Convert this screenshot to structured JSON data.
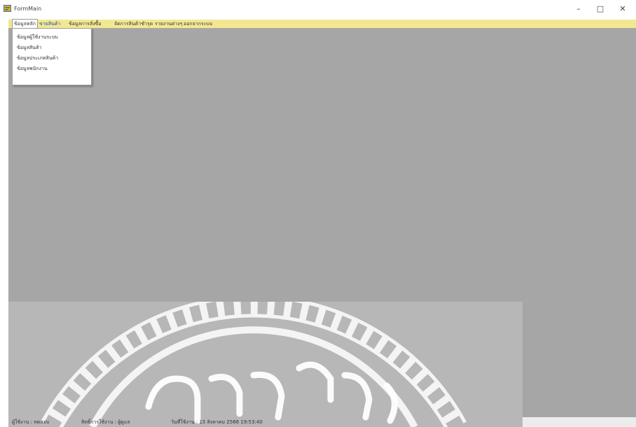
{
  "window": {
    "title": "FormMain",
    "minimize_glyph": "–",
    "maximize_glyph": "□",
    "close_glyph": "✕",
    "icon": "app-form-icon"
  },
  "menu": {
    "items": [
      {
        "label": "ข้อมูลหลัก",
        "state": "open"
      },
      {
        "label": "ขายสินค้า",
        "state": "highlighted"
      },
      {
        "label": "ข้อมูลการสั่งซื้อ",
        "state": "normal"
      },
      {
        "label": "จัดการสินค้าชำรุด",
        "state": "normal"
      },
      {
        "label": "รายงานต่างๆ",
        "state": "normal"
      },
      {
        "label": "ออกจากระบบ",
        "state": "normal"
      }
    ]
  },
  "dropdown": {
    "items": [
      "ข้อมูลผู้ใช้งานระบบ",
      "ข้อมูลสินค้า",
      "ข้อมูลประเภทสินค้า",
      "ข้อมูลพนักงาน"
    ]
  },
  "status": {
    "user_label": "ผู้ใช้งาน : ทดสอบ",
    "role_label": "สิทธิ์การใช้งาน : ผู้ดูแล",
    "date_label": "วันที่ใช้งาน : 15 สิงหาคม 2566  19:53:40"
  },
  "watermark": {
    "text": "วิทยาลัยฯ",
    "kind": "university-seal-watermark"
  },
  "colors": {
    "menubar": "#f3e892",
    "mdi_background": "#a6a6a6",
    "watermark_panel": "#b7b7b7"
  }
}
